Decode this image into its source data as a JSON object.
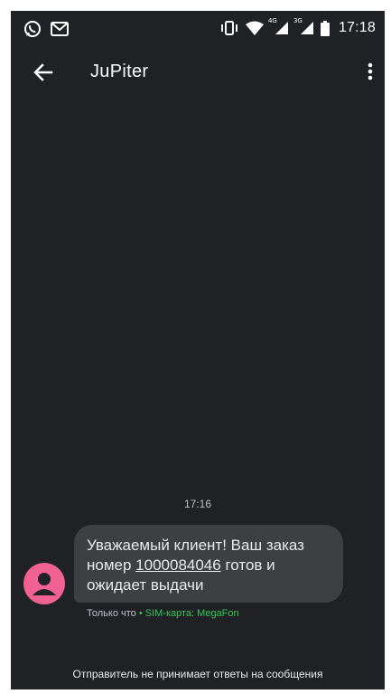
{
  "status_bar": {
    "left_icons": [
      "whatsapp-icon",
      "gmail-icon"
    ],
    "right_icons": [
      "vibrate-icon",
      "wifi-icon",
      "signal-4g-icon",
      "signal-3g-icon",
      "battery-icon"
    ],
    "network_4g": "4G",
    "network_3g": "3G",
    "time": "17:18"
  },
  "app_bar": {
    "title": "JuPiter",
    "back_icon": "arrow-back-icon",
    "menu_icon": "more-vert-icon"
  },
  "conversation": {
    "timestamp": "17:16",
    "message": {
      "text_before": "Уважаемый клиент! Ваш заказ номер ",
      "order_number": "1000084046",
      "text_after": " готов и ожидает выдачи",
      "meta_time": "Только что",
      "meta_separator": "•",
      "meta_sim": "SIM-карта: MegaFon"
    }
  },
  "footer": {
    "notice": "Отправитель не принимает ответы на сообщения"
  },
  "colors": {
    "background": "#202124",
    "bubble": "#3c4043",
    "avatar": "#f06292",
    "sim_label": "#34c759"
  }
}
